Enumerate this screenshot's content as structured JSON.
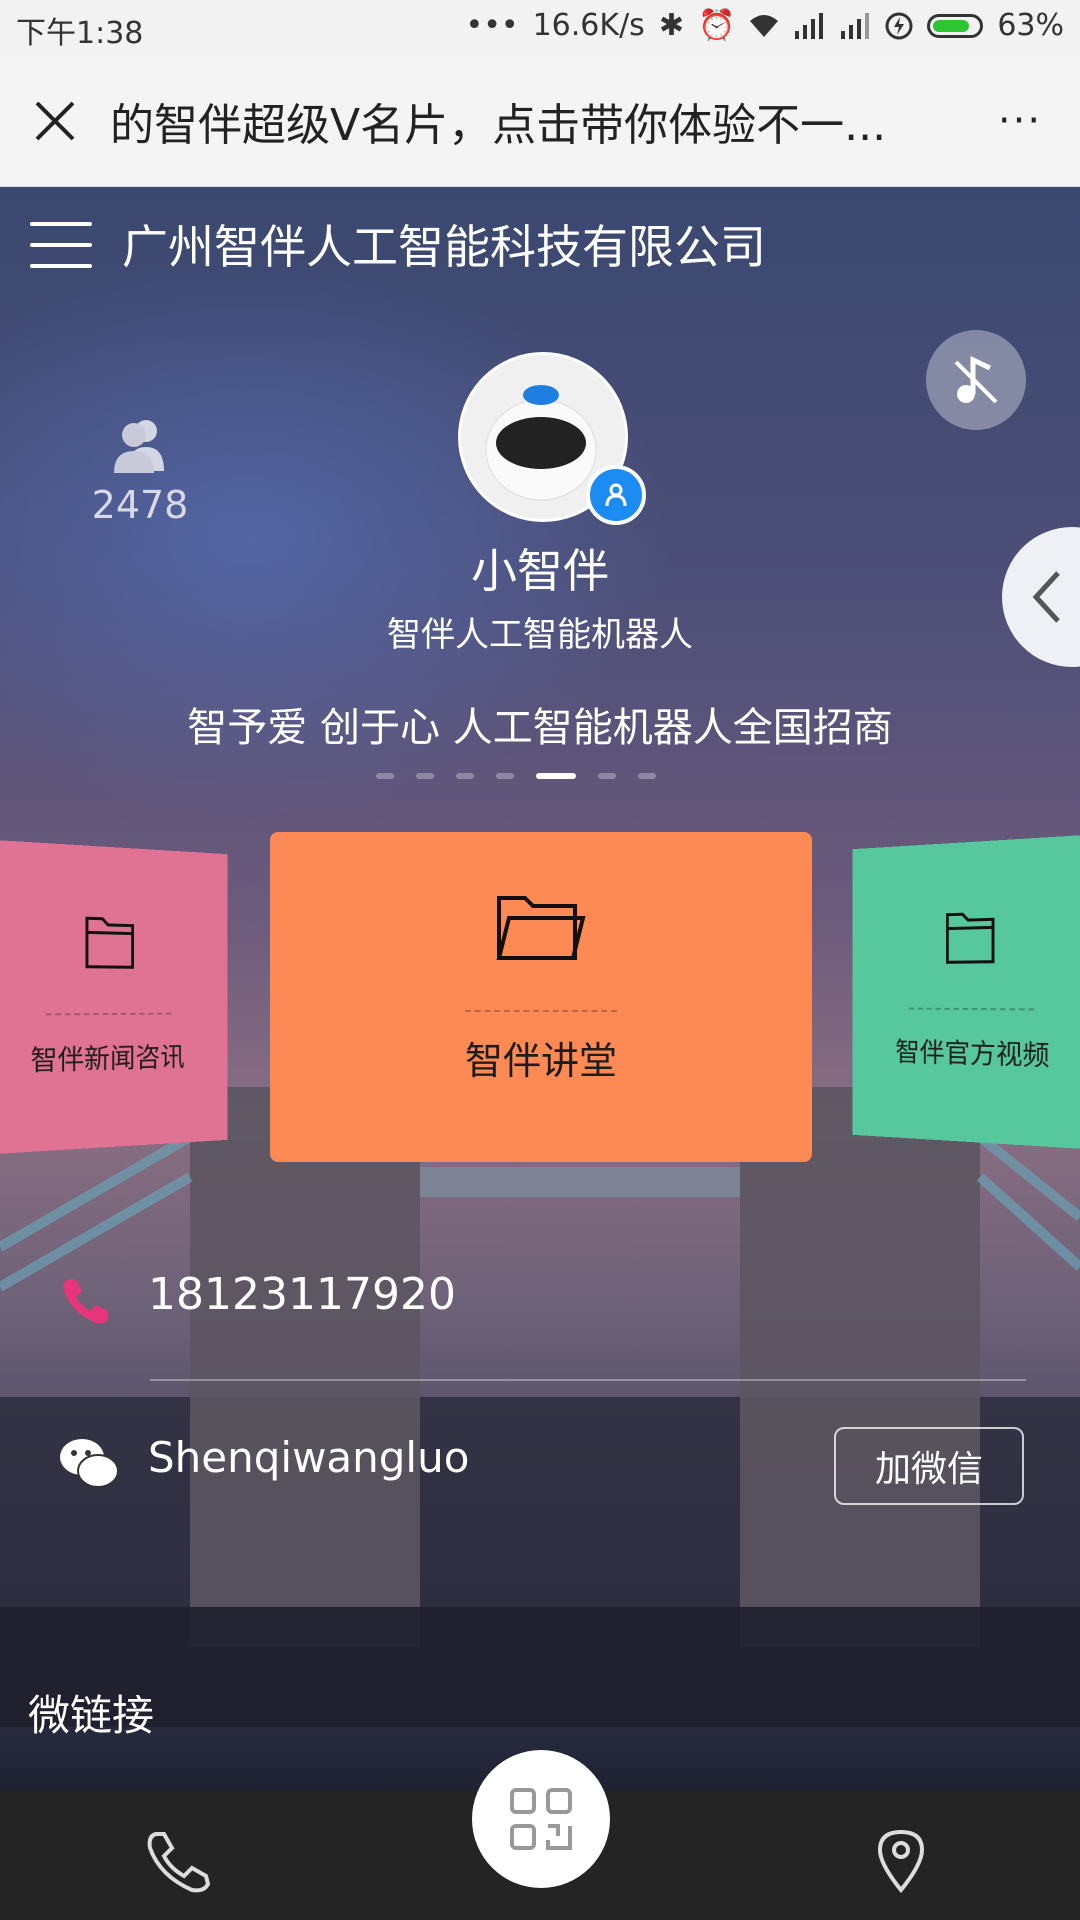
{
  "status_bar": {
    "time": "下午1:38",
    "network_speed": "16.6K/s",
    "battery_percent": "63%",
    "icons": [
      "ellipsis-icon",
      "bluetooth-icon",
      "alarm-icon",
      "wifi-icon",
      "hd-signal-icon",
      "signal-icon",
      "charging-icon",
      "battery-icon"
    ]
  },
  "title_bar": {
    "title": "的智伴超级V名片，点击带你体验不一...",
    "more": "···"
  },
  "header": {
    "company": "广州智伴人工智能科技有限公司"
  },
  "profile": {
    "viewer_count": "2478",
    "name": "小智伴",
    "role": "智伴人工智能机器人",
    "slogan": "智予爱 创于心 人工智能机器人全国招商"
  },
  "carousel": {
    "dots": 7,
    "active_index": 4,
    "cards": [
      {
        "label": "智伴新闻咨讯",
        "color": "#e07293"
      },
      {
        "label": "智伴讲堂",
        "color": "#fd8a55"
      },
      {
        "label": "智伴官方视频",
        "color": "#57c79d"
      }
    ]
  },
  "contact": {
    "phone": "18123117920",
    "wechat_id": "Shenqiwangluo",
    "add_wechat": "加微信"
  },
  "sections": {
    "micro_link": "微链接"
  },
  "colors": {
    "accent_blue": "#1c8cf2",
    "phone_pink": "#e8357a",
    "bottom_bar": "#242424"
  }
}
